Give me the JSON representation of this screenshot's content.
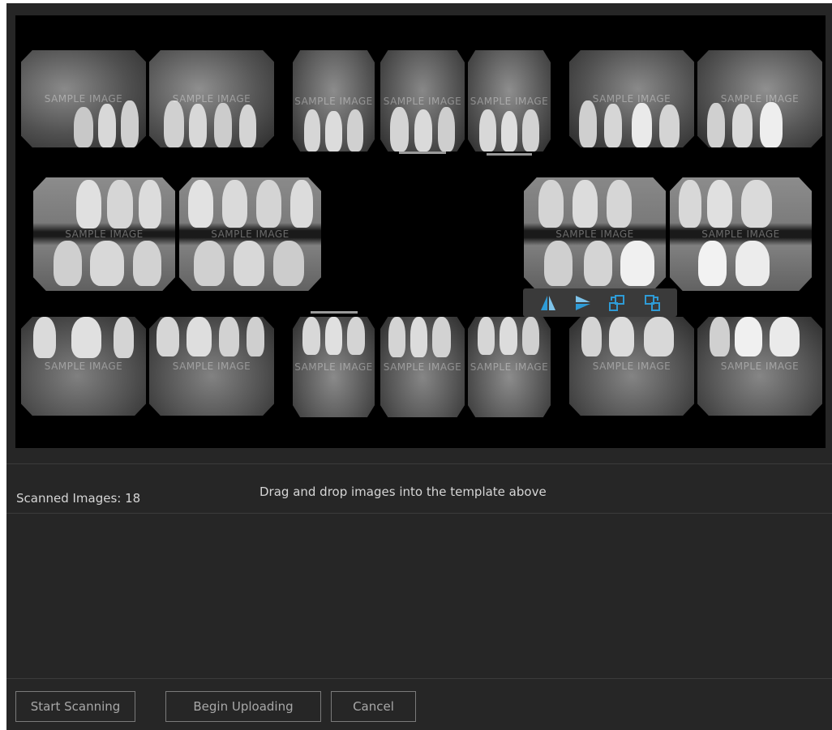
{
  "watermark": "SAMPLE IMAGE",
  "status": {
    "scanned_label": "Scanned Images: 18",
    "drop_hint": "Drag and drop images into the template above"
  },
  "toolbar": {
    "icons": [
      "flip-horizontal-icon",
      "flip-vertical-icon",
      "rotate-left-icon",
      "rotate-right-icon"
    ],
    "accent": "#2e9bd6"
  },
  "buttons": {
    "start_scanning": "Start Scanning",
    "begin_uploading": "Begin Uploading",
    "cancel": "Cancel"
  },
  "colors": {
    "panel_bg": "#262626",
    "viewer_bg": "#000000",
    "text": "#d6d6d6",
    "button_border": "#7a7a7a"
  }
}
